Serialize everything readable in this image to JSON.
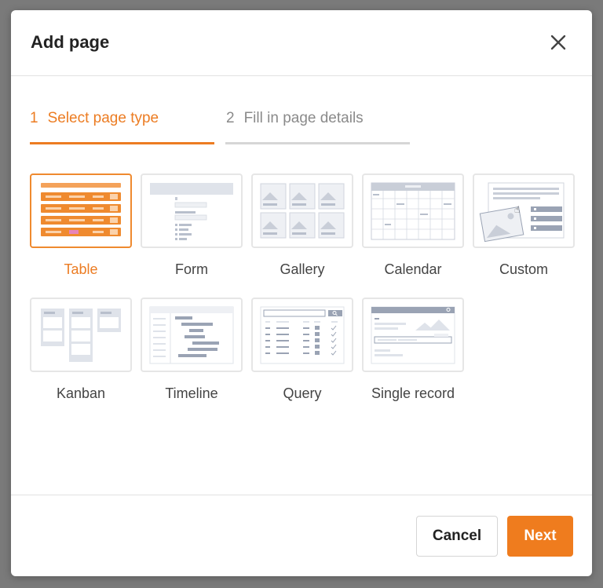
{
  "dialog": {
    "title": "Add page"
  },
  "steps": [
    {
      "number": "1",
      "label": "Select page type"
    },
    {
      "number": "2",
      "label": "Fill in page details"
    }
  ],
  "page_types": [
    {
      "id": "table",
      "label": "Table",
      "icon": "table-preview-icon",
      "selected": true
    },
    {
      "id": "form",
      "label": "Form",
      "icon": "form-preview-icon",
      "selected": false
    },
    {
      "id": "gallery",
      "label": "Gallery",
      "icon": "gallery-preview-icon",
      "selected": false
    },
    {
      "id": "calendar",
      "label": "Calendar",
      "icon": "calendar-preview-icon",
      "selected": false
    },
    {
      "id": "custom",
      "label": "Custom",
      "icon": "custom-preview-icon",
      "selected": false
    },
    {
      "id": "kanban",
      "label": "Kanban",
      "icon": "kanban-preview-icon",
      "selected": false
    },
    {
      "id": "timeline",
      "label": "Timeline",
      "icon": "timeline-preview-icon",
      "selected": false
    },
    {
      "id": "query",
      "label": "Query",
      "icon": "query-preview-icon",
      "selected": false
    },
    {
      "id": "single-record",
      "label": "Single record",
      "icon": "single-record-preview-icon",
      "selected": false
    }
  ],
  "footer": {
    "cancel_label": "Cancel",
    "next_label": "Next"
  },
  "colors": {
    "accent": "#ef7c1e",
    "accent_light": "#f7c08f",
    "muted": "#c9ccd4",
    "muted_dark": "#9aa3b4",
    "inactive_text": "#8a8a8a",
    "inactive_bar": "#d6d6d6"
  }
}
